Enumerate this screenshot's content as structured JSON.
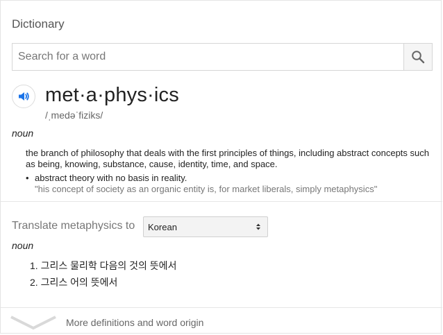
{
  "dictionary": {
    "title": "Dictionary",
    "search": {
      "placeholder": "Search for a word",
      "value": ""
    },
    "entry": {
      "headword": "met·a·phys·ics",
      "phonetic": "/ˌmedəˈfiziks/",
      "part_of_speech": "noun",
      "definition": "the branch of philosophy that deals with the first principles of things, including abstract concepts such as being, knowing, substance, cause, identity, time, and space.",
      "subdefinitions": [
        {
          "bullet": "•",
          "text": "abstract theory with no basis in reality.",
          "example": "\"his concept of society as an organic entity is, for market liberals, simply metaphysics\""
        }
      ]
    },
    "translate": {
      "label": "Translate metaphysics to",
      "language": "Korean",
      "part_of_speech": "noun",
      "items": [
        "1. 그리스 물리학 다음의 것의 뜻에서",
        "2. 그리스 어의 뜻에서"
      ]
    },
    "more_link": "More definitions and word origin",
    "colors": {
      "accent": "#1a73e8",
      "muted": "#777777"
    }
  }
}
